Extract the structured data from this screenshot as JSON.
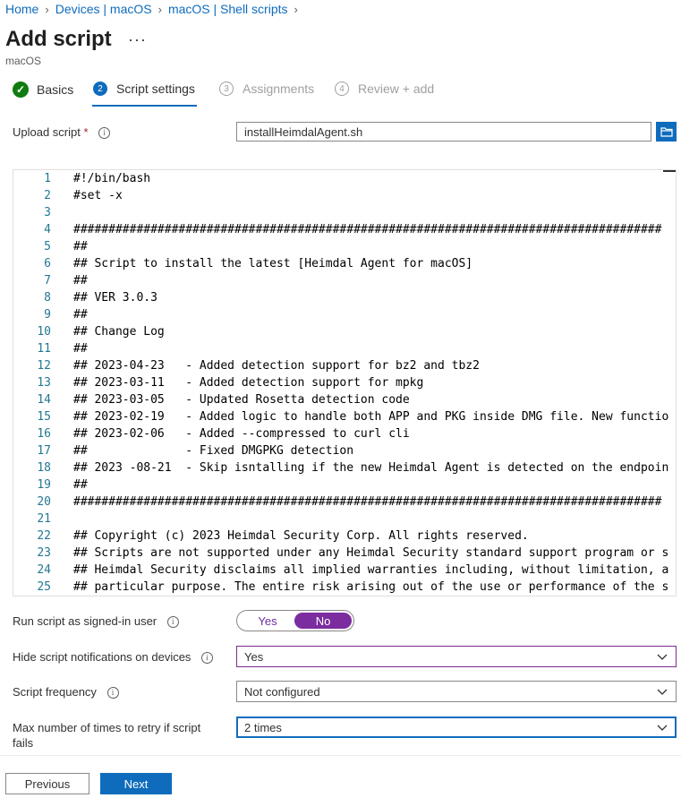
{
  "breadcrumb": [
    "Home",
    "Devices | macOS",
    "macOS | Shell scripts"
  ],
  "page": {
    "title": "Add script",
    "subtitle": "macOS",
    "more": "···"
  },
  "tabs": [
    {
      "label": "Basics",
      "state": "complete"
    },
    {
      "label": "Script settings",
      "number": "2",
      "state": "active"
    },
    {
      "label": "Assignments",
      "number": "3",
      "state": "disabled"
    },
    {
      "label": "Review + add",
      "number": "4",
      "state": "disabled"
    }
  ],
  "upload": {
    "label": "Upload script",
    "required_mark": "*",
    "value": "installHeimdalAgent.sh"
  },
  "code": [
    {
      "n": "1",
      "t": "#!/bin/bash"
    },
    {
      "n": "2",
      "t": "#set -x"
    },
    {
      "n": "3",
      "t": ""
    },
    {
      "n": "4",
      "t": "####################################################################################"
    },
    {
      "n": "5",
      "t": "##"
    },
    {
      "n": "6",
      "t": "## Script to install the latest [Heimdal Agent for macOS]"
    },
    {
      "n": "7",
      "t": "##"
    },
    {
      "n": "8",
      "t": "## VER 3.0.3"
    },
    {
      "n": "9",
      "t": "##"
    },
    {
      "n": "10",
      "t": "## Change Log"
    },
    {
      "n": "11",
      "t": "##"
    },
    {
      "n": "12",
      "t": "## 2023-04-23   - Added detection support for bz2 and tbz2"
    },
    {
      "n": "13",
      "t": "## 2023-03-11   - Added detection support for mpkg"
    },
    {
      "n": "14",
      "t": "## 2023-03-05   - Updated Rosetta detection code"
    },
    {
      "n": "15",
      "t": "## 2023-02-19   - Added logic to handle both APP and PKG inside DMG file. New functio"
    },
    {
      "n": "16",
      "t": "## 2023-02-06   - Added --compressed to curl cli"
    },
    {
      "n": "17",
      "t": "##              - Fixed DMGPKG detection"
    },
    {
      "n": "18",
      "t": "## 2023 -08-21  - Skip isntalling if the new Heimdal Agent is detected on the endpoin"
    },
    {
      "n": "19",
      "t": "##"
    },
    {
      "n": "20",
      "t": "####################################################################################"
    },
    {
      "n": "21",
      "t": ""
    },
    {
      "n": "22",
      "t": "## Copyright (c) 2023 Heimdal Security Corp. All rights reserved."
    },
    {
      "n": "23",
      "t": "## Scripts are not supported under any Heimdal Security standard support program or s"
    },
    {
      "n": "24",
      "t": "## Heimdal Security disclaims all implied warranties including, without limitation, a"
    },
    {
      "n": "25",
      "t": "## particular purpose. The entire risk arising out of the use or performance of the s"
    }
  ],
  "signed_in": {
    "label": "Run script as signed-in user",
    "yes": "Yes",
    "no": "No",
    "selected": "No"
  },
  "hide_notifications": {
    "label": "Hide script notifications on devices",
    "value": "Yes"
  },
  "frequency": {
    "label": "Script frequency",
    "value": "Not configured"
  },
  "retry": {
    "label_line1": "Max number of times to retry if script",
    "label_line2": "fails",
    "value": "2 times"
  },
  "footer": {
    "previous": "Previous",
    "next": "Next"
  },
  "colors": {
    "accent": "#0f6cbd",
    "toggle_on": "#7b2c9e",
    "success": "#107c10"
  }
}
